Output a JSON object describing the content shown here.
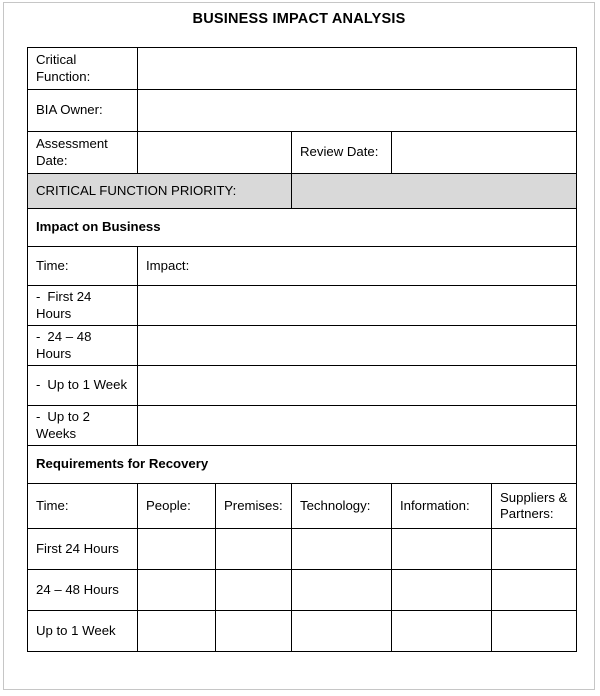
{
  "document": {
    "title": "BUSINESS IMPACT ANALYSIS",
    "page_border_color": "#c6c6c6",
    "grid_color": "#000000",
    "highlight_color": "#d9d9d9"
  },
  "header_fields": {
    "critical_function_label": "Critical Function:",
    "critical_function_value": "",
    "bia_owner_label": "BIA Owner:",
    "bia_owner_value": "",
    "assessment_date_label": "Assessment Date:",
    "assessment_date_value": "",
    "review_date_label": "Review Date:",
    "review_date_value": "",
    "priority_label": "CRITICAL FUNCTION PRIORITY:",
    "priority_value": ""
  },
  "impact_section": {
    "heading": "Impact on Business",
    "col_time": "Time:",
    "col_impact": "Impact:",
    "dash": "-",
    "rows": [
      {
        "time": "First 24 Hours",
        "impact": ""
      },
      {
        "time": "24 – 48 Hours",
        "impact": ""
      },
      {
        "time": "Up to 1 Week",
        "impact": ""
      },
      {
        "time": "Up to 2 Weeks",
        "impact": ""
      }
    ]
  },
  "recovery_section": {
    "heading": "Requirements for Recovery",
    "columns": [
      "Time:",
      "People:",
      "Premises:",
      "Technology:",
      "Information:",
      "Suppliers & Partners:"
    ],
    "rows": [
      {
        "time": "First 24 Hours",
        "people": "",
        "premises": "",
        "technology": "",
        "information": "",
        "suppliers": ""
      },
      {
        "time": "24 – 48 Hours",
        "people": "",
        "premises": "",
        "technology": "",
        "information": "",
        "suppliers": ""
      },
      {
        "time": "Up to 1 Week",
        "people": "",
        "premises": "",
        "technology": "",
        "information": "",
        "suppliers": ""
      }
    ]
  }
}
